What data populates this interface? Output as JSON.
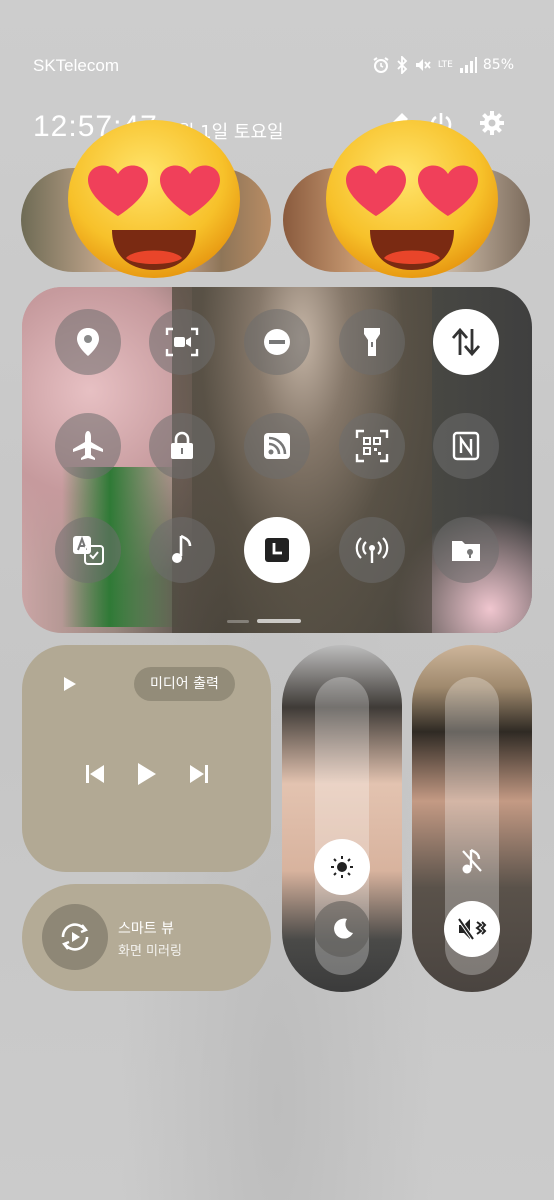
{
  "status_bar": {
    "carrier": "SKTelecom",
    "network": "LTE",
    "battery": "85%"
  },
  "header": {
    "time": "12:57:47",
    "date": "· 2월 1일 토요일"
  },
  "quick_settings": {
    "tiles": [
      {
        "name": "location",
        "on": false
      },
      {
        "name": "screen-recorder",
        "on": false
      },
      {
        "name": "do-not-disturb",
        "on": false
      },
      {
        "name": "flashlight",
        "on": false
      },
      {
        "name": "mobile-data",
        "on": true
      },
      {
        "name": "airplane-mode",
        "on": false
      },
      {
        "name": "secure-folder",
        "on": false
      },
      {
        "name": "rss-feed",
        "on": false
      },
      {
        "name": "qr-scanner",
        "on": false
      },
      {
        "name": "nfc",
        "on": false
      },
      {
        "name": "auto-translate",
        "on": false
      },
      {
        "name": "sound",
        "on": false
      },
      {
        "name": "clock",
        "on": true
      },
      {
        "name": "hotspot",
        "on": false
      },
      {
        "name": "folder",
        "on": false
      }
    ],
    "page_count": 2,
    "active_page": 1
  },
  "media": {
    "output_label": "미디어 출력"
  },
  "smart_view": {
    "title": "스마트 뷰",
    "subtitle": "화면 미러링"
  },
  "sliders": {
    "brightness_level": 0.35,
    "volume_level": 0.35
  }
}
